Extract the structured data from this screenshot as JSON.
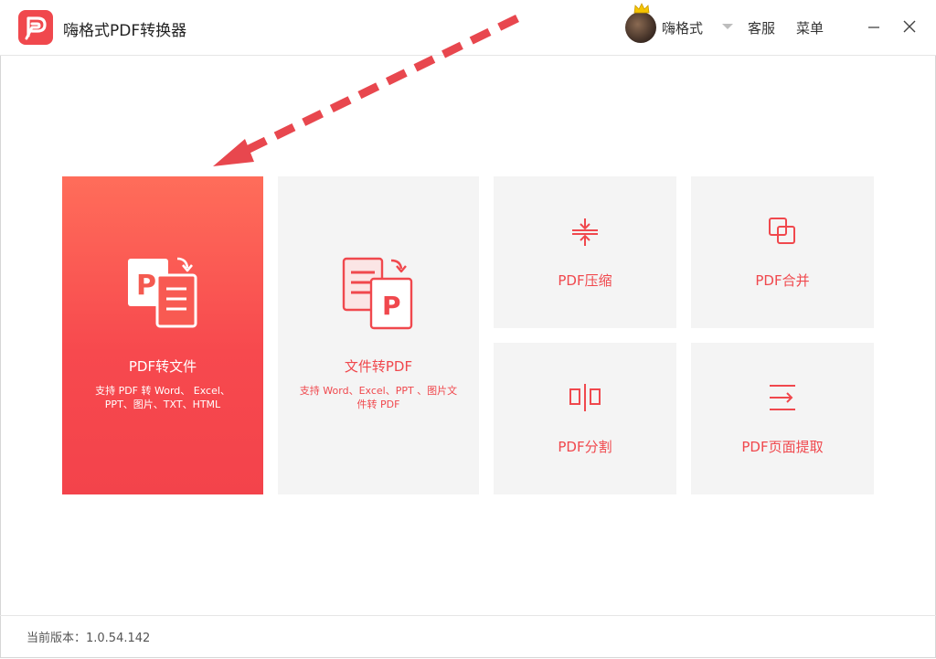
{
  "app": {
    "title": "嗨格式PDF转换器",
    "brand_color": "#f0484d"
  },
  "header": {
    "username": "嗨格式",
    "support_label": "客服",
    "menu_label": "菜单"
  },
  "cards": {
    "pdf_to_file": {
      "label": "PDF转文件",
      "desc_line1": "支持 PDF 转 Word、 Excel、",
      "desc_line2": "PPT、图片、TXT、HTML",
      "icon": "pdf-to-document-icon"
    },
    "file_to_pdf": {
      "label": "文件转PDF",
      "desc_line1": "支持 Word、Excel、PPT 、图片文",
      "desc_line2": "件转 PDF",
      "icon": "document-to-pdf-icon"
    },
    "compress": {
      "label": "PDF压缩",
      "icon": "compress-icon"
    },
    "merge": {
      "label": "PDF合并",
      "icon": "merge-icon"
    },
    "split": {
      "label": "PDF分割",
      "icon": "split-icon"
    },
    "extract": {
      "label": "PDF页面提取",
      "icon": "page-extract-icon"
    }
  },
  "footer": {
    "version_text": "当前版本：1.0.54.142"
  },
  "annotation": {
    "arrow_color": "#e8474e",
    "icon": "dashed-arrow-annotation"
  }
}
